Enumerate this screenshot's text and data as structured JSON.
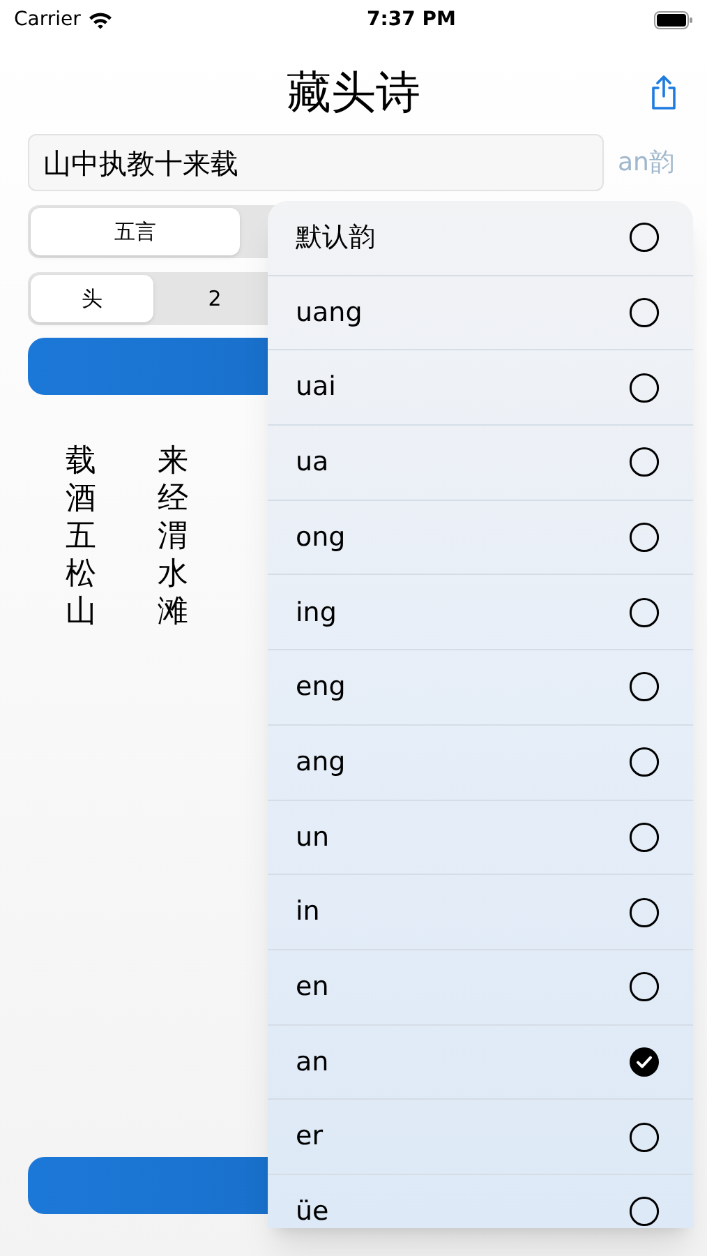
{
  "status_bar": {
    "carrier": "Carrier",
    "time": "7:37 PM"
  },
  "title": "藏头诗",
  "input": {
    "value": "山中执教十来载"
  },
  "rhyme_label": "an韵",
  "length_tabs": [
    {
      "label": "五言",
      "selected": true
    }
  ],
  "position_tabs": [
    {
      "label": "头",
      "selected": true
    },
    {
      "label": "2",
      "selected": false
    }
  ],
  "poem_columns": [
    [
      "载",
      "酒",
      "五",
      "松",
      "山"
    ],
    [
      "来",
      "经",
      "渭",
      "水",
      "滩"
    ]
  ],
  "rhyme_menu": [
    {
      "label": "默认韵",
      "selected": false
    },
    {
      "label": "uang",
      "selected": false
    },
    {
      "label": "uai",
      "selected": false
    },
    {
      "label": "ua",
      "selected": false
    },
    {
      "label": "ong",
      "selected": false
    },
    {
      "label": "ing",
      "selected": false
    },
    {
      "label": "eng",
      "selected": false
    },
    {
      "label": "ang",
      "selected": false
    },
    {
      "label": "un",
      "selected": false
    },
    {
      "label": "in",
      "selected": false
    },
    {
      "label": "en",
      "selected": false
    },
    {
      "label": "an",
      "selected": true
    },
    {
      "label": "er",
      "selected": false
    },
    {
      "label": "üe",
      "selected": false
    }
  ]
}
